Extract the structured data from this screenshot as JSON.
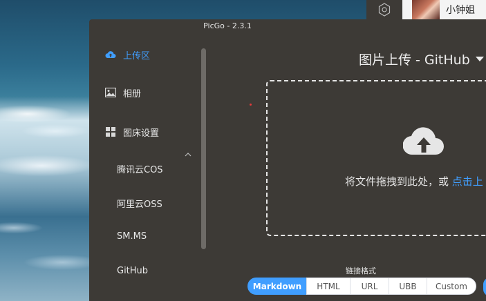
{
  "topbar": {
    "settings_icon": "hexagon-gear-icon",
    "username": "小钟姐"
  },
  "window": {
    "title": "PicGo - 2.3.1"
  },
  "sidebar": {
    "items": [
      {
        "label": "上传区",
        "icon": "cloud-upload-icon",
        "active": true
      },
      {
        "label": "相册",
        "icon": "image-icon",
        "active": false
      },
      {
        "label": "图床设置",
        "icon": "grid-icon",
        "active": false
      }
    ],
    "sub_items": [
      "腾讯云COS",
      "阿里云OSS",
      "SM.MS",
      "GitHub"
    ],
    "accent": "#409eff"
  },
  "main": {
    "title": "图片上传 - GitHub",
    "drop_text": "将文件拖拽到此处，或 ",
    "drop_link": "点击上",
    "format_label": "链接格式",
    "formats": [
      "Markdown",
      "HTML",
      "URL",
      "UBB",
      "Custom"
    ],
    "selected_format": "Markdown"
  }
}
